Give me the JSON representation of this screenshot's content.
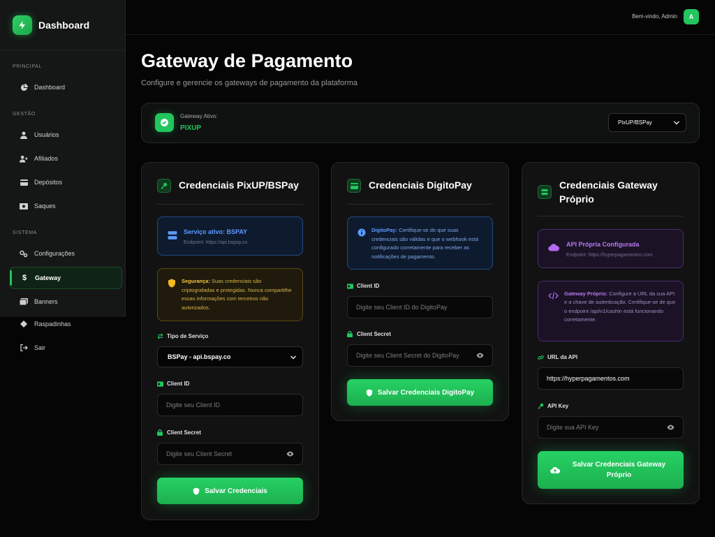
{
  "sidebar": {
    "brand": "Dashboard",
    "sections": [
      "PRINCIPAL",
      "GESTÃO",
      "SISTEMA"
    ],
    "items": [
      {
        "label": "Dashboard",
        "icon": "pie-chart-icon"
      },
      {
        "label": "Usuários",
        "icon": "user-icon"
      },
      {
        "label": "Afiliados",
        "icon": "user-plus-icon"
      },
      {
        "label": "Depósitos",
        "icon": "credit-card-icon"
      },
      {
        "label": "Saques",
        "icon": "money-icon"
      },
      {
        "label": "Configurações",
        "icon": "gears-icon"
      },
      {
        "label": "Gateway",
        "icon": "dollar-icon",
        "active": true
      },
      {
        "label": "Banners",
        "icon": "images-icon"
      },
      {
        "label": "Raspadinhas",
        "icon": "diamond-icon"
      },
      {
        "label": "Sair",
        "icon": "logout-icon"
      }
    ]
  },
  "topbar": {
    "welcome": "Bem-vindo, Admin",
    "avatar": "A"
  },
  "page": {
    "title": "Gateway de Pagamento",
    "subtitle": "Configure e gerencie os gateways de pagamento da plataforma"
  },
  "active_gateway": {
    "label": "Gateway Ativo:",
    "value": "PIXUP",
    "select": "PixUP/BSPay"
  },
  "pixup": {
    "title": "Credenciais PixUP/BSPay",
    "service_title": "Serviço ativo: BSPAY",
    "service_endpoint": "Endpoint: https://api.bspay.co",
    "security_bold": "Segurança:",
    "security_text": "Suas credenciais são criptografadas e protegidas. Nunca compartilhe essas informações com terceiros não autorizados.",
    "service_type_label": "Tipo de Serviço",
    "service_type_value": "BSPay - api.bspay.co",
    "client_id_label": "Client ID",
    "client_id_placeholder": "Digite seu Client ID",
    "client_secret_label": "Client Secret",
    "client_secret_placeholder": "Digite seu Client Secret",
    "save": "Salvar Credenciais"
  },
  "digitopay": {
    "title": "Credenciais DigitoPay",
    "info_bold": "DigitoPay:",
    "info_text": "Certifique-se de que suas credenciais são válidas e que o webhook está configurado corretamente para receber as notificações de pagamento.",
    "client_id_label": "Client ID",
    "client_id_placeholder": "Digite seu Client ID do DigitoPay",
    "client_secret_label": "Client Secret",
    "client_secret_placeholder": "Digite seu Client Secret do DigitoPay",
    "save": "Salvar Credenciais DigitoPay"
  },
  "proprio": {
    "title": "Credenciais Gateway Próprio",
    "api_title": "API Própria Configurada",
    "api_endpoint": "Endpoint: https://hyperpagamentos.com",
    "info_bold": "Gateway Próprio:",
    "info_text": "Configure a URL da sua API e a chave de autenticação. Certifique-se de que o endpoint /api/v1/cashin está funcionando corretamente.",
    "url_label": "URL da API",
    "url_value": "https://hyperpagamentos.com",
    "key_label": "API Key",
    "key_placeholder": "Digite sua API Key",
    "save": "Salvar Credenciais Gateway Próprio"
  },
  "colors": {
    "accent": "#22c55e",
    "info_blue": "#5b9bff",
    "warning": "#f5b820",
    "purple": "#b26af0"
  }
}
